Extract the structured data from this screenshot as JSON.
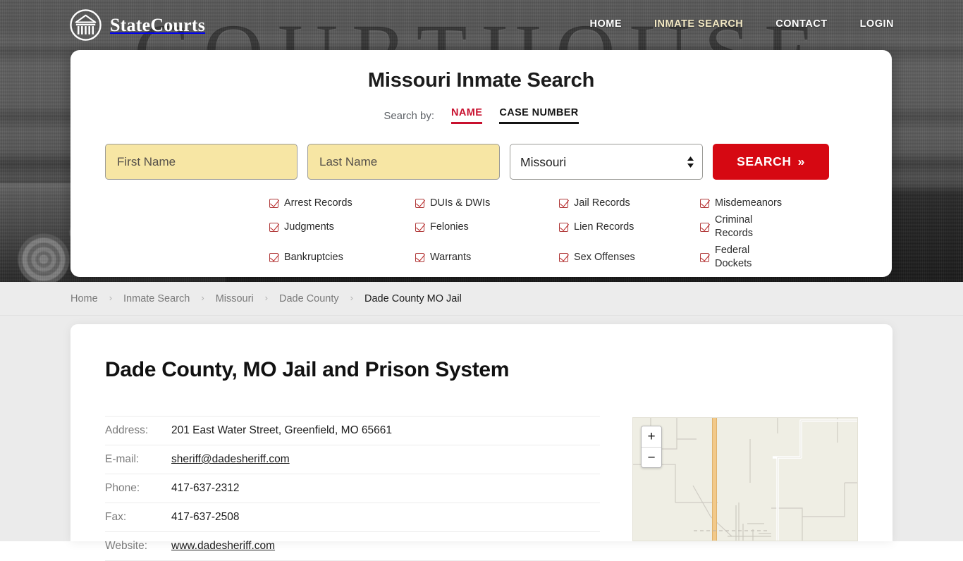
{
  "brand": {
    "name": "StateCourts",
    "mark": "courthouse-logo-icon"
  },
  "topnav": [
    {
      "label": "HOME",
      "active": false
    },
    {
      "label": "INMATE SEARCH",
      "active": true
    },
    {
      "label": "CONTACT",
      "active": false
    },
    {
      "label": "LOGIN",
      "active": false
    }
  ],
  "hero": {
    "backdrop_word": "COURTHOUSE"
  },
  "search": {
    "title": "Missouri Inmate Search",
    "search_by_label": "Search by:",
    "tabs": [
      {
        "label": "NAME",
        "active": true,
        "color": "#c8102e"
      },
      {
        "label": "CASE NUMBER",
        "active": false,
        "color": "#141414"
      }
    ],
    "first_name_placeholder": "First Name",
    "first_name_value": "",
    "last_name_placeholder": "Last Name",
    "last_name_value": "",
    "state_selected": "Missouri",
    "state_options": [
      "Missouri"
    ],
    "button_label": "SEARCH",
    "button_chevron": "»",
    "button_color": "#d60812",
    "input_fill": "#f7e6a4",
    "record_types": [
      "Arrest Records",
      "DUIs & DWIs",
      "Jail Records",
      "Misdemeanors",
      "Judgments",
      "Felonies",
      "Lien Records",
      "Criminal Records",
      "Bankruptcies",
      "Warrants",
      "Sex Offenses",
      "Federal Dockets"
    ]
  },
  "breadcrumb": {
    "separator": "›",
    "items": [
      {
        "label": "Home",
        "current": false
      },
      {
        "label": "Inmate Search",
        "current": false
      },
      {
        "label": "Missouri",
        "current": false
      },
      {
        "label": "Dade County",
        "current": false
      },
      {
        "label": "Dade County MO Jail",
        "current": true
      }
    ]
  },
  "page": {
    "title": "Dade County, MO Jail and Prison System",
    "details": [
      {
        "label": "Address:",
        "value": "201 East Water Street, Greenfield, MO 65661",
        "link": false
      },
      {
        "label": "E-mail:",
        "value": "sheriff@dadesheriff.com",
        "link": true
      },
      {
        "label": "Phone:",
        "value": "417-637-2312",
        "link": false
      },
      {
        "label": "Fax:",
        "value": "417-637-2508",
        "link": false
      },
      {
        "label": "Website:",
        "value": "www.dadesheriff.com",
        "link": true
      }
    ]
  },
  "map": {
    "zoom_in_label": "+",
    "zoom_out_label": "−",
    "background_color": "#efeee4",
    "highway_color": "#f2c98a"
  }
}
